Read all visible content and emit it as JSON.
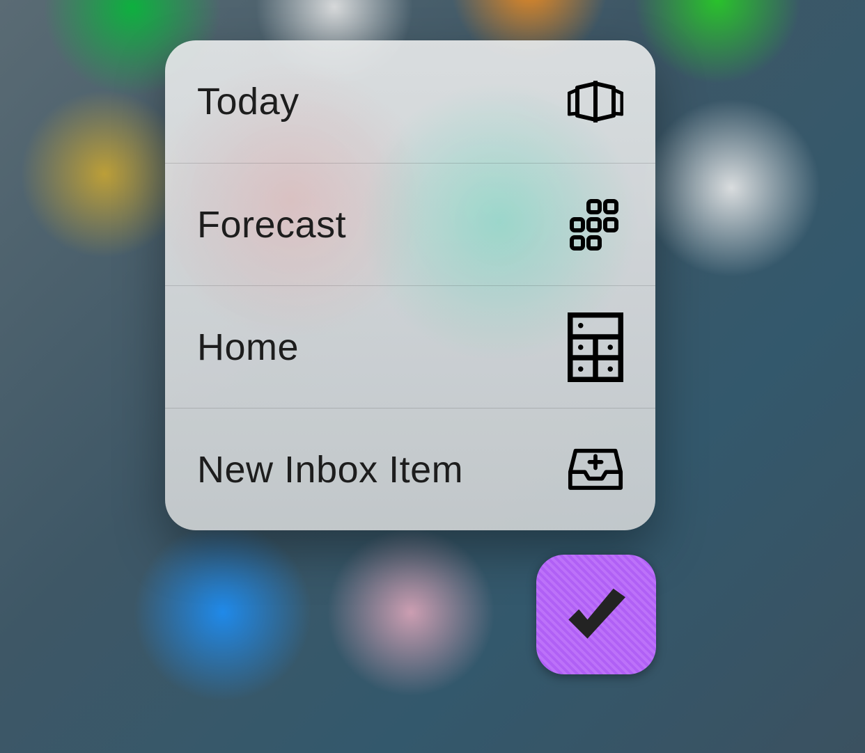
{
  "menu": {
    "items": [
      {
        "label": "Today",
        "icon_name": "today-panels-icon"
      },
      {
        "label": "Forecast",
        "icon_name": "forecast-grid-icon"
      },
      {
        "label": "Home",
        "icon_name": "home-project-icon"
      },
      {
        "label": "New Inbox Item",
        "icon_name": "new-inbox-icon"
      }
    ]
  },
  "app_icon": {
    "name": "omnifocus-app-icon",
    "accent": "#b060f5",
    "check_color": "#232323"
  }
}
